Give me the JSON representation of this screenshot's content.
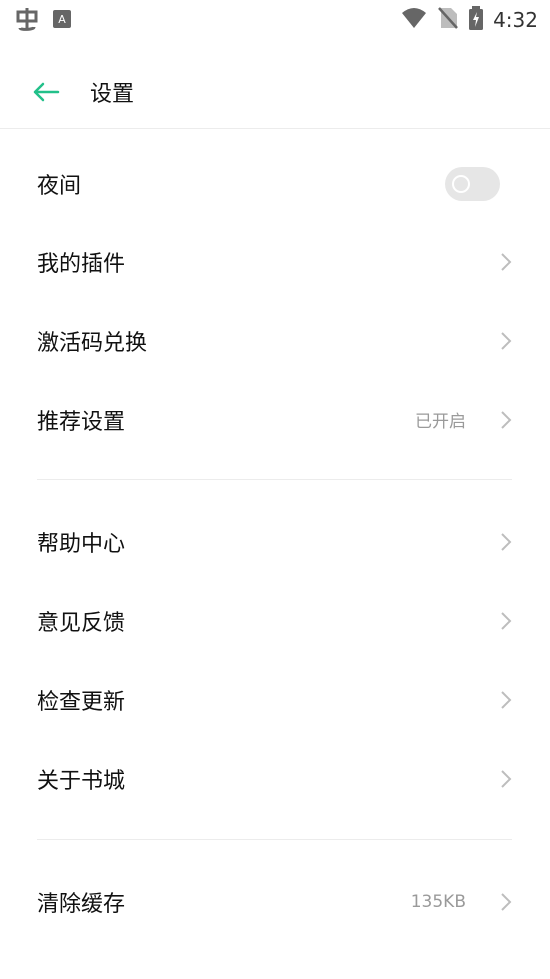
{
  "status_bar": {
    "time": "4:32",
    "icons": [
      "bug-icon",
      "a-app-icon",
      "wifi-icon",
      "no-sim-icon",
      "battery-charging-icon"
    ]
  },
  "header": {
    "back_icon": "arrow-left-icon",
    "title": "设置"
  },
  "colors": {
    "accent": "#22c08a",
    "chevron": "#bdbdbd",
    "toggle_off": "#e6e6e6",
    "divider": "#ececec",
    "secondary_text": "#9a9a9a"
  },
  "groups": [
    {
      "items": [
        {
          "label": "夜间",
          "control": "toggle",
          "toggle_on": false
        },
        {
          "label": "我的插件"
        },
        {
          "label": "激活码兑换"
        },
        {
          "label": "推荐设置",
          "value": "已开启"
        }
      ]
    },
    {
      "items": [
        {
          "label": "帮助中心"
        },
        {
          "label": "意见反馈"
        },
        {
          "label": "检查更新"
        },
        {
          "label": "关于书城"
        }
      ]
    },
    {
      "items": [
        {
          "label": "清除缓存",
          "value": "135KB"
        }
      ]
    }
  ]
}
